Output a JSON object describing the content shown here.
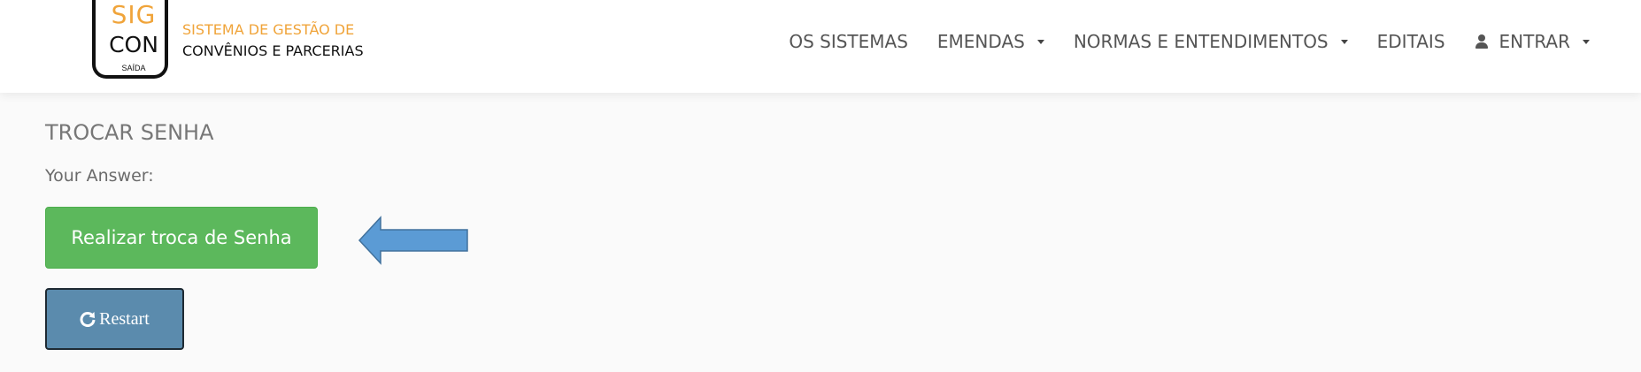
{
  "logo": {
    "sig": "SIG",
    "con": "CON",
    "saida": "SAÍDA",
    "line1": "SISTEMA DE GESTÃO DE",
    "line2": "CONVÊNIOS E PARCERIAS"
  },
  "nav": {
    "items": [
      {
        "label": "OS SISTEMAS"
      },
      {
        "label": "EMENDAS"
      },
      {
        "label": "NORMAS E ENTENDIMENTOS"
      },
      {
        "label": "EDITAIS"
      },
      {
        "label": "ENTRAR"
      }
    ]
  },
  "main": {
    "title": "TROCAR SENHA",
    "answer_label": "Your Answer:",
    "primary_button": "Realizar troca de Senha",
    "restart_button": "Restart"
  },
  "colors": {
    "brand_orange": "#f0a43a",
    "button_green": "#5cb85c",
    "button_restart": "#5b8bad",
    "arrow_blue": "#5b9bd5"
  },
  "icons": {
    "arrow": "left-arrow-icon",
    "restart": "refresh-icon",
    "user": "user-icon"
  }
}
